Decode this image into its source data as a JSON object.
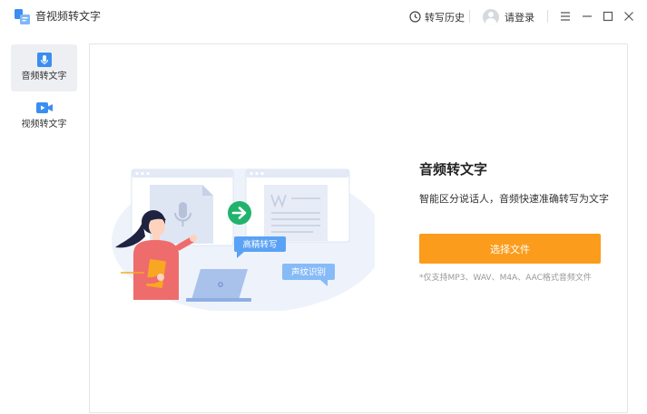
{
  "app": {
    "title": "音视频转文字"
  },
  "header": {
    "history_label": "转写历史",
    "login_label": "请登录"
  },
  "sidebar": {
    "items": [
      {
        "label": "音频转文字",
        "icon": "microphone-icon",
        "active": true
      },
      {
        "label": "视频转文字",
        "icon": "video-camera-icon",
        "active": false
      }
    ]
  },
  "main": {
    "title": "音频转文字",
    "subtitle": "智能区分说话人，音频快速准确转写为文字",
    "choose_button": "选择文件",
    "formats_note": "*仅支持MP3、WAV、M4A、AAC格式音频文件",
    "bubble_1": "高精转写",
    "bubble_2": "声纹识别"
  },
  "colors": {
    "accent": "#fb9c1c",
    "brand_blue": "#3a8ef0",
    "green": "#21b36c",
    "bubble_blue": "#5aa2f5"
  }
}
